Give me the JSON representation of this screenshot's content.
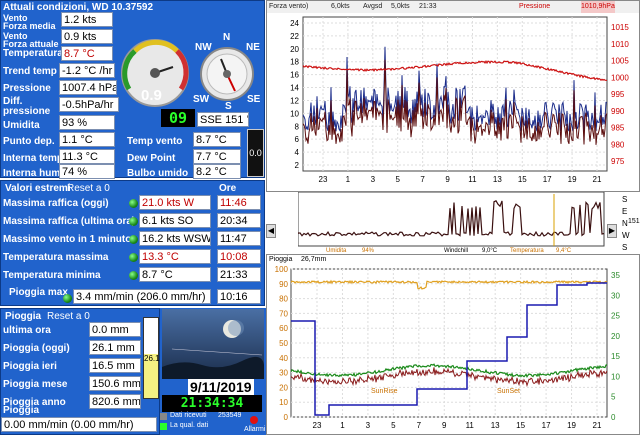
{
  "current": {
    "title": "Attuali condizioni, WD 10.37592",
    "wind_label": "Vento",
    "wind_avg_label": "Forza media",
    "wind_avg_value": "1.2 kts",
    "wind_now_label": "Vento",
    "wind_now_label2": "Forza attuale",
    "wind_now_value": "0.9 kts",
    "temp_label": "Temperatura",
    "temp_value": "8.7 °C",
    "trend_label": "Trend temp",
    "trend_value": "-1.2 °C /hr",
    "pressure_label": "Pressione",
    "pressure_value": "1007.4 hPa",
    "diff_label1": "Diff.",
    "diff_label2": "pressione",
    "diff_value": "-0.5hPa/hr",
    "humidity_label": "Umidita",
    "humidity_value": "93 %",
    "dew_label": "Punto dep.",
    "dew_value": "1.1 °C",
    "int_temp_label": "Interna temp",
    "int_temp_value": "11.3 °C",
    "int_hum_label": "Interna hum",
    "int_hum_value": "74 %",
    "gauge_value": "0.9",
    "dir_big": "09",
    "dir_value": "SSE 151 °",
    "compass": {
      "n": "N",
      "nw": "NW",
      "ne": "NE",
      "sw": "SW",
      "se": "SE",
      "s": "S"
    },
    "windchill_label": "Temp vento",
    "windchill_value": "8.7 °C",
    "dewpoint_label": "Dew Point",
    "dewpoint_value": "7.7 °C",
    "wetbulb_label": "Bulbo umido",
    "wetbulb_value": "8.2 °C",
    "side_value": "0.0"
  },
  "extremes": {
    "title": "Valori estremi",
    "reset": "Reset a 0",
    "ore": "Ore",
    "rows": [
      {
        "label": "Massima raffica (oggi)",
        "value": "21.0 kts  W",
        "time": "11:46",
        "red": true
      },
      {
        "label": "Massima raffica (ultima ora)",
        "value": "6.1 kts  SO",
        "time": "20:34",
        "red": false
      },
      {
        "label": "Massimo vento in 1 minuto",
        "value": "16.2 kts WSW",
        "time": "11:47",
        "red": false
      },
      {
        "label": "Temperatura massima",
        "value": "13.3 °C",
        "time": "10:08",
        "red": true
      },
      {
        "label": "Temperatura minima",
        "value": "8.7 °C",
        "time": "21:33",
        "red": false
      }
    ],
    "rain_max_label": "Pioggia max",
    "rain_max_value": "3.4 mm/min (206.0 mm/hr)",
    "rain_max_time": "10:16"
  },
  "rain": {
    "title": "Pioggia",
    "reset": "Reset a 0",
    "rows": [
      {
        "label": "ultima ora",
        "value": "0.0 mm"
      },
      {
        "label": "Pioggia (oggi)",
        "value": "26.1 mm"
      },
      {
        "label": "Pioggia ieri",
        "value": "16.5 mm"
      },
      {
        "label": "Pioggia mese",
        "value": "150.6 mm"
      },
      {
        "label": "Pioggia anno",
        "value": "820.6 mm"
      }
    ],
    "rate_label": "Pioggia",
    "rate_value": "0.00 mm/min (0.00 mm/hr)",
    "bar_label": "26.1",
    "bar_fraction": 0.55
  },
  "moon": {
    "date": "9/11/2019",
    "time": "21:34:34"
  },
  "status": {
    "received": "Dati ricevuti",
    "quality": "La qual. dati",
    "count": "253549",
    "alarm": "Allarmi"
  },
  "graph1": {
    "header": {
      "a": "Forza vento)",
      "b": "6,0kts",
      "c": "Avgsd",
      "d": "5,0kts",
      "e": "21:33",
      "f": "Pressione",
      "g": "1010,9hPa"
    },
    "left_ticks": [
      "24",
      "22",
      "20",
      "18",
      "16",
      "14",
      "12",
      "10",
      "8",
      "6",
      "4",
      "2"
    ],
    "right_ticks": [
      "1015",
      "1010",
      "1005",
      "1000",
      "995",
      "990",
      "985",
      "980",
      "975"
    ],
    "x_ticks": [
      "23",
      "1",
      "3",
      "5",
      "7",
      "9",
      "11",
      "13",
      "15",
      "17",
      "19",
      "21"
    ],
    "colors": {
      "wind": "#1b2c8a",
      "avg": "#5c0e0e",
      "pressure": "#cc1111"
    }
  },
  "graph2": {
    "labels": {
      "a": "Umidita",
      "b": "94%",
      "c": "Windchill",
      "d": "9,0°C",
      "e": "Temperatura",
      "f": "9,4°C"
    },
    "dirs": [
      "S",
      "E",
      "N",
      "W",
      "S"
    ],
    "dir_num": "151"
  },
  "graph3": {
    "header": {
      "a": "Pioggia",
      "b": "26,7mm"
    },
    "left_ticks": [
      "100",
      "90",
      "80",
      "70",
      "60",
      "50",
      "40",
      "30",
      "20",
      "10",
      "0"
    ],
    "right_ticks": [
      "35",
      "30",
      "25",
      "20",
      "15",
      "10",
      "5",
      "0"
    ],
    "x_ticks": [
      "23",
      "1",
      "3",
      "5",
      "7",
      "9",
      "11",
      "13",
      "15",
      "17",
      "19",
      "21"
    ],
    "sunrise": "SunRise",
    "sunset": "SunSet"
  }
}
